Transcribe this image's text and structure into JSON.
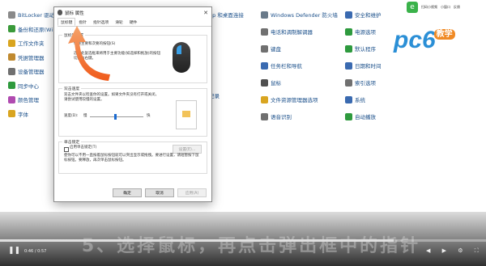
{
  "control_panel": {
    "col1": [
      {
        "label": "BitLocker 驱动",
        "icon": "bitlocker-icon",
        "color": "#8a8a8a"
      },
      {
        "label": "备份和还原(Wi",
        "icon": "backup-icon",
        "color": "#3a9a3a"
      },
      {
        "label": "工作文件夹",
        "icon": "work-folders-icon",
        "color": "#d9a520"
      },
      {
        "label": "凭据管理器",
        "icon": "credential-icon",
        "color": "#c08a30"
      },
      {
        "label": "设备管理器",
        "icon": "device-manager-icon",
        "color": "#707070"
      },
      {
        "label": "同步中心",
        "icon": "sync-center-icon",
        "color": "#2e9a3e"
      },
      {
        "label": "颜色管理",
        "icon": "color-management-icon",
        "color": "#b04ab0"
      },
      {
        "label": "字体",
        "icon": "fonts-icon",
        "color": "#d9a520"
      }
    ],
    "col2_partial": [
      {
        "label": "pp 和桌面连接"
      },
      {
        "label": "记录"
      }
    ],
    "col3": [
      {
        "label": "Windows Defender 防火墙",
        "icon": "firewall-icon",
        "color": "#6a7a8a"
      },
      {
        "label": "电话和调制解调器",
        "icon": "phone-modem-icon",
        "color": "#707070"
      },
      {
        "label": "键盘",
        "icon": "keyboard-icon",
        "color": "#707070"
      },
      {
        "label": "任务栏和导航",
        "icon": "taskbar-icon",
        "color": "#3a6ab0"
      },
      {
        "label": "鼠标",
        "icon": "mouse-icon",
        "color": "#505050"
      },
      {
        "label": "文件资源管理器选项",
        "icon": "explorer-options-icon",
        "color": "#d9a520"
      },
      {
        "label": "语音识别",
        "icon": "speech-icon",
        "color": "#707070"
      }
    ],
    "col4": [
      {
        "label": "安全和维护",
        "icon": "security-icon",
        "color": "#3a6ab0"
      },
      {
        "label": "电源选项",
        "icon": "power-icon",
        "color": "#2e9a3e"
      },
      {
        "label": "默认程序",
        "icon": "default-programs-icon",
        "color": "#2e9a3e"
      },
      {
        "label": "日期和时间",
        "icon": "datetime-icon",
        "color": "#3a6ab0"
      },
      {
        "label": "索引选项",
        "icon": "index-icon",
        "color": "#707070"
      },
      {
        "label": "系统",
        "icon": "system-icon",
        "color": "#3a6ab0"
      },
      {
        "label": "自动播放",
        "icon": "autoplay-icon",
        "color": "#2e9a3e"
      }
    ]
  },
  "watermark": {
    "brand": "pc6",
    "tag": "教学",
    "app_labels": [
      "扫码小视频",
      "小窗口",
      "反馈"
    ]
  },
  "dialog": {
    "title": "鼠标 属性",
    "close": "✕",
    "tabs": [
      "鼠标键",
      "指针",
      "指针选项",
      "滑轮",
      "硬件"
    ],
    "active_tab": 0,
    "group1": {
      "title": "鼠标键配置",
      "checkbox_label": "切换主要和次要的按钮(S)",
      "desc": "选择此复选框来将用于主要功能(如选择和拖放)的按钮切换为右键。"
    },
    "group2": {
      "title": "双击速度",
      "desc": "双击文件夹以检查你的设置。如果文件夹没有打开或关闭，请尝试使用较慢的设置。",
      "slider_label": "速度(D):",
      "slow": "慢",
      "fast": "快"
    },
    "group3": {
      "title": "单击锁定",
      "checkbox_label": "启用单击锁定(T)",
      "settings_button": "设置(E)...",
      "desc": "使你可以不用一直按着鼠标按钮就可以突出显示或拖拽。要进行设置，请短暂按下鼠标按钮。要释放，再次单击鼠标按钮。"
    },
    "buttons": {
      "ok": "确定",
      "cancel": "取消",
      "apply": "应用(A)"
    }
  },
  "video": {
    "subtitle": "5、选择鼠标，再点击弹出框中的指针",
    "time": "0:46 / 0:57",
    "progress": 0.81
  }
}
